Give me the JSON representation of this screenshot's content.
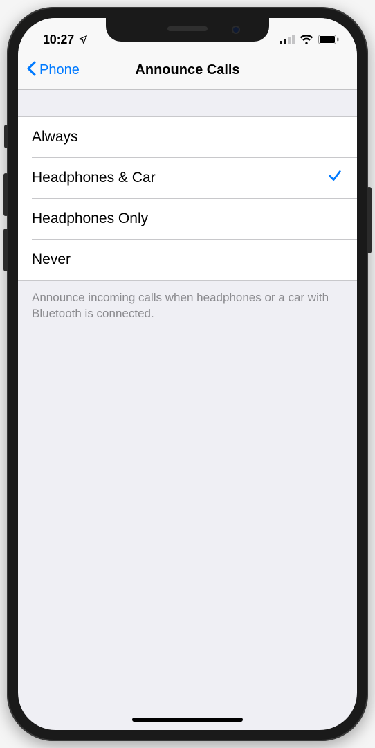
{
  "status": {
    "time": "10:27",
    "location_icon": "location-arrow",
    "cell_bars_active": 2,
    "cell_bars_total": 4,
    "wifi": true,
    "battery_full": true
  },
  "nav": {
    "back_label": "Phone",
    "title": "Announce Calls"
  },
  "options": [
    {
      "label": "Always",
      "selected": false
    },
    {
      "label": "Headphones & Car",
      "selected": true
    },
    {
      "label": "Headphones Only",
      "selected": false
    },
    {
      "label": "Never",
      "selected": false
    }
  ],
  "footer": "Announce incoming calls when headphones or a car with Bluetooth is connected.",
  "colors": {
    "accent": "#007aff",
    "bg": "#efeff4"
  }
}
